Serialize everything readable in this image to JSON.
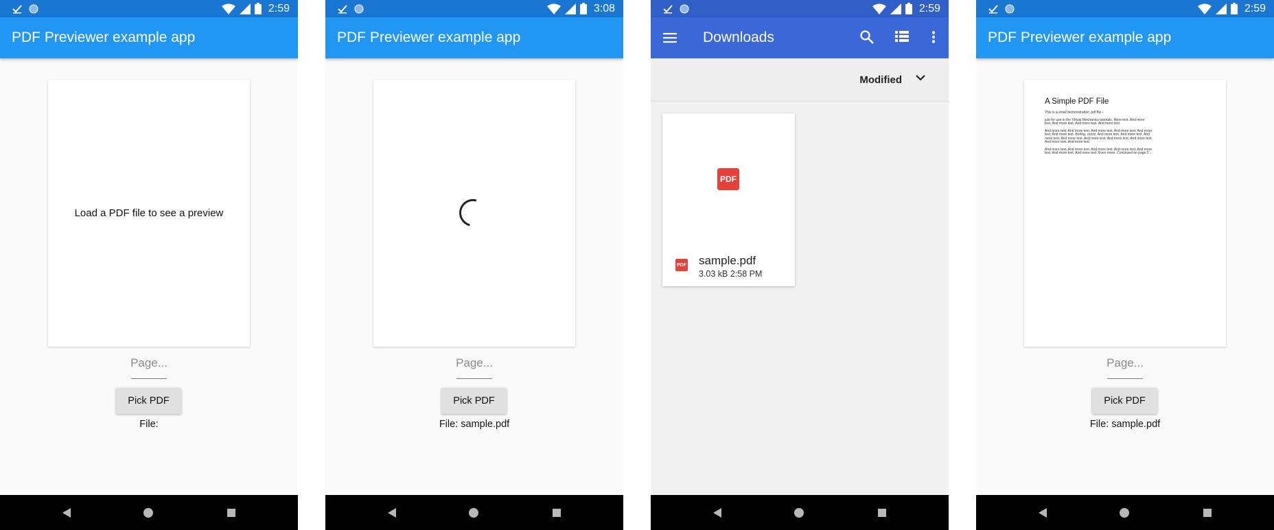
{
  "screens": [
    {
      "status": {
        "time": "2:59"
      },
      "app_title": "PDF Previewer example app",
      "preview_placeholder": "Load a PDF file to see a preview",
      "page_placeholder": "Page...",
      "pick_label": "Pick PDF",
      "file_label": "File:"
    },
    {
      "status": {
        "time": "3:08"
      },
      "app_title": "PDF Previewer example app",
      "page_placeholder": "Page...",
      "pick_label": "Pick PDF",
      "file_label": "File: sample.pdf"
    },
    {
      "status": {
        "time": "2:59"
      },
      "title": "Downloads",
      "sort_label": "Modified",
      "file": {
        "badge": "PDF",
        "name": "sample.pdf",
        "size": "3.03 kB",
        "time": "2:58 PM"
      }
    },
    {
      "status": {
        "time": "2:59"
      },
      "app_title": "PDF Previewer example app",
      "preview": {
        "title": "A Simple PDF File",
        "paragraphs": [
          [
            "This is a small demonstration .pdf file -"
          ],
          [
            "just for use in the Virtual Mechanics tutorials. More text. And more",
            "text. And more text. And more text. And more text."
          ],
          [
            "And more text. And more text. And more text. And more text. And more",
            "text. And more text. Boring, zzzzz. And more text. And more text. And",
            "more text. And more text. And more text. And more text. And more text.",
            "And more text. And more text."
          ],
          [
            "And more text. And more text. And more text. And more text. And more",
            "text. And more text. And more text. Even more. Continued on page 2 ..."
          ]
        ]
      },
      "page_placeholder": "Page...",
      "pick_label": "Pick PDF",
      "file_label": "File: sample.pdf"
    }
  ],
  "colors": {
    "app_bar": "#2196f3",
    "status_bar": "#1976d2",
    "downloads_bar": "#3a68d8",
    "pdf_red": "#e5403a"
  },
  "icons": [
    "check-icon",
    "circle-icon",
    "wifi-icon",
    "signal-icon",
    "battery-icon",
    "menu-icon",
    "search-icon",
    "list-view-icon",
    "more-vert-icon",
    "chevron-down-icon",
    "pdf-icon",
    "back-icon",
    "home-icon",
    "recents-icon"
  ]
}
